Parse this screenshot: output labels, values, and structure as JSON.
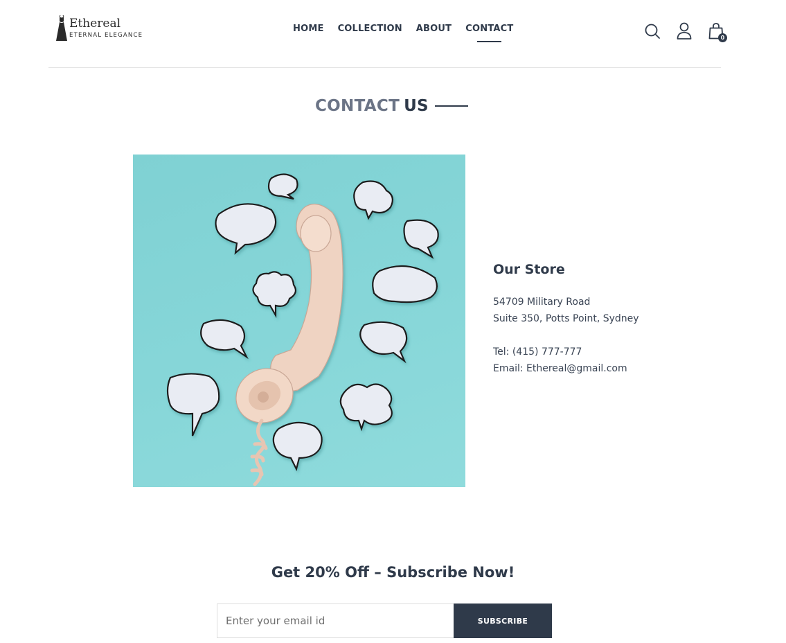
{
  "header": {
    "logo": {
      "title": "Ethereal",
      "subtitle": "ETERNAL ELEGANCE"
    },
    "nav": {
      "home": "HOME",
      "collection": "COLLECTION",
      "about": "ABOUT",
      "contact": "CONTACT",
      "active": "contact"
    },
    "icons": [
      "search-icon",
      "user-icon",
      "bag-icon"
    ],
    "cart_count": "0"
  },
  "title": {
    "part1": "CONTACT",
    "part2": "US"
  },
  "store": {
    "heading": "Our Store",
    "address_line1": "54709 Military Road",
    "address_line2": "Suite 350, Potts Point, Sydney",
    "tel": "Tel: (415) 777-777",
    "email": "Email: Ethereal@gmail.com"
  },
  "subscribe": {
    "heading": "Get 20% Off – Subscribe Now!",
    "placeholder": "Enter your email id",
    "button": "SUBSCRIBE"
  },
  "colors": {
    "primary": "#2f3a4a",
    "muted": "#6b7486",
    "image_bg": "#86d6d8"
  }
}
